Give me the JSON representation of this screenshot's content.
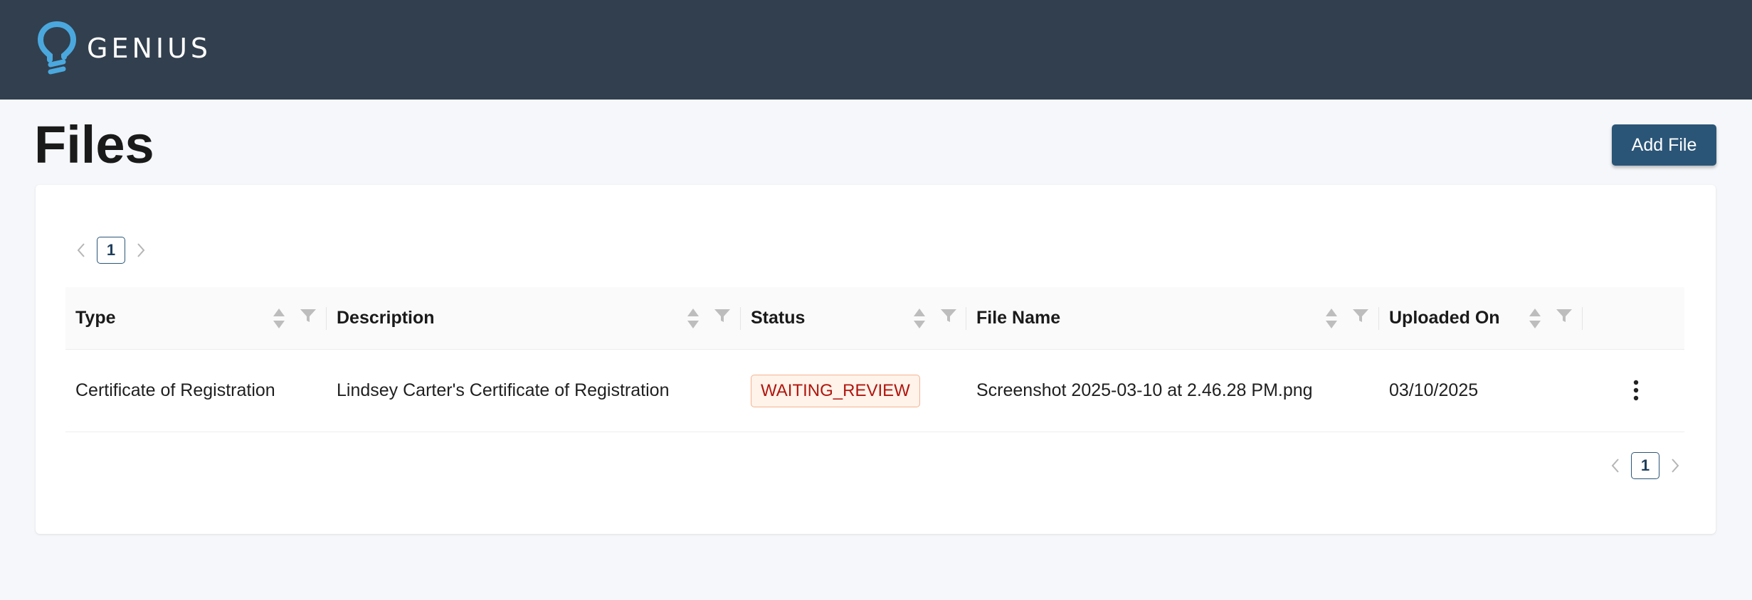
{
  "header": {
    "brand": "GENIUS",
    "logo_icon": "lightbulb-logo-icon"
  },
  "page": {
    "title": "Files",
    "add_button_label": "Add File"
  },
  "pagination": {
    "current_page": "1",
    "prev_icon": "chevron-left-icon",
    "next_icon": "chevron-right-icon"
  },
  "table": {
    "columns": [
      {
        "label": "Type"
      },
      {
        "label": "Description"
      },
      {
        "label": "Status"
      },
      {
        "label": "File Name"
      },
      {
        "label": "Uploaded On"
      }
    ],
    "rows": [
      {
        "type": "Certificate of Registration",
        "description": "Lindsey Carter's Certificate of Registration",
        "status": "WAITING_REVIEW",
        "file_name": "Screenshot 2025-03-10 at 2.46.28 PM.png",
        "uploaded_on": "03/10/2025",
        "actions_icon": "more-vertical-icon"
      }
    ]
  },
  "colors": {
    "topbar": "#323f4e",
    "accent": "#2b5577",
    "logo": "#4aa8de",
    "status_text": "#b0160e",
    "status_border": "#f4b38f"
  }
}
